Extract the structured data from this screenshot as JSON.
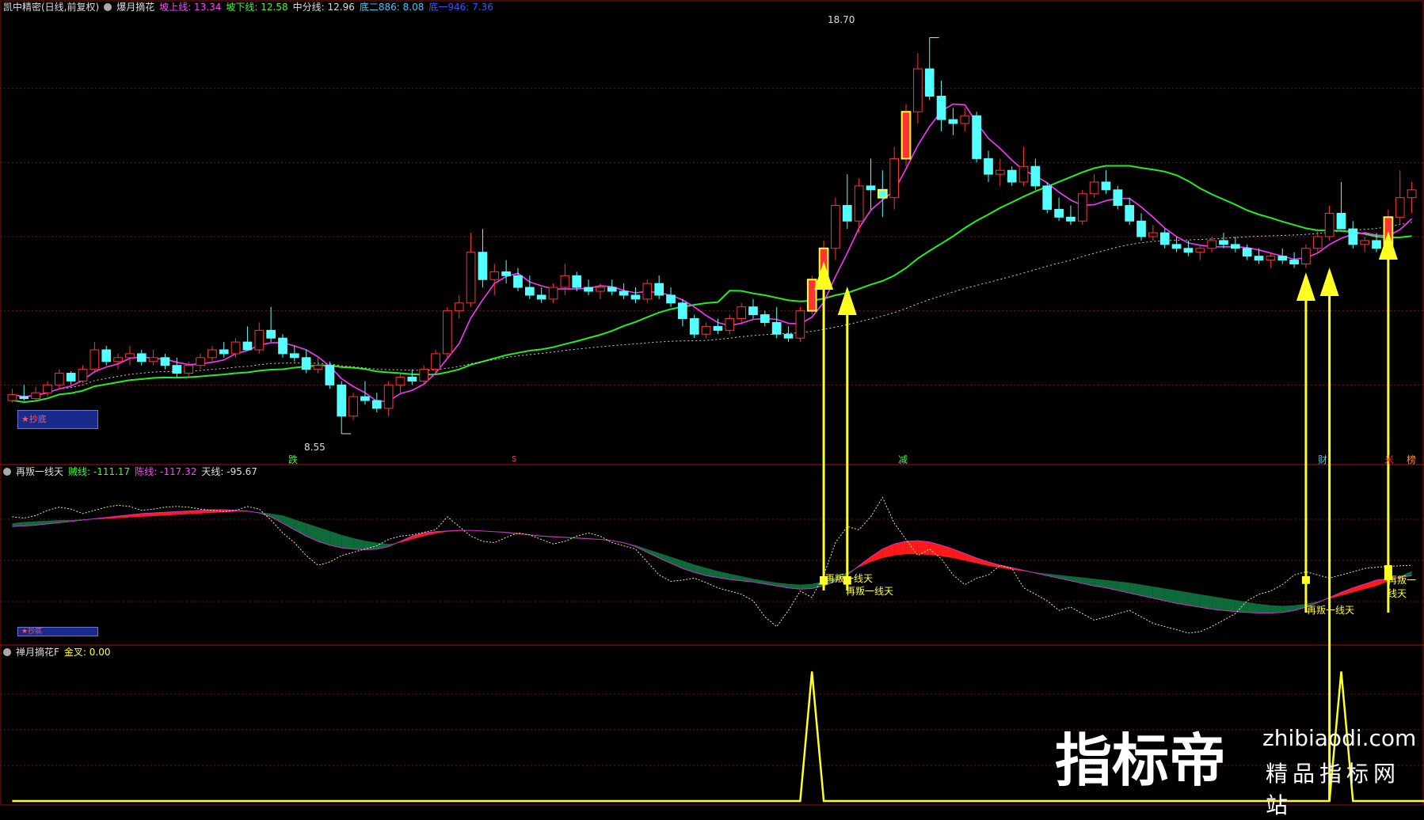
{
  "pane1": {
    "title": "凯中精密(日线,前复权)",
    "indicator": "爆月摘花",
    "items": [
      {
        "label": "坡上线: 13.34",
        "color": "#ff44ff"
      },
      {
        "label": "坡下线: 12.58",
        "color": "#33ff33"
      },
      {
        "label": "中分线: 12.96",
        "color": "#dddddd"
      },
      {
        "label": "底二886: 8.08",
        "color": "#33ccff"
      },
      {
        "label": "底一946: 7.36",
        "color": "#3355ff"
      }
    ],
    "high_label": "18.70",
    "low_label": "8.55",
    "signals": [
      {
        "text": "跌",
        "color": "#33ff33"
      },
      {
        "text": "s",
        "color": "#ff3333"
      },
      {
        "text": "减",
        "color": "#33ff33"
      },
      {
        "text": "财",
        "color": "#33ccff"
      },
      {
        "text": "米",
        "color": "#ff3333"
      },
      {
        "text": "榜",
        "color": "#ff8833"
      }
    ],
    "badge": "★抄底"
  },
  "pane2": {
    "title": "再叛一线天",
    "items": [
      {
        "label": "贼线: -111.17",
        "color": "#33ff33"
      },
      {
        "label": "陈线: -117.32",
        "color": "#ff44ff"
      },
      {
        "label": "天线: -95.67",
        "color": "#dddddd"
      }
    ],
    "signal_label": "再叛一线天",
    "badge": "★抄底"
  },
  "pane3": {
    "title": "禅月摘花F",
    "items": [
      {
        "label": "金叉: 0.00",
        "color": "#ffff33"
      }
    ]
  },
  "watermark": {
    "big": "指标帝",
    "url": "zhibiaodi.com",
    "sub": "精品指标网站"
  },
  "chart_data": {
    "type": "candlestick",
    "price": {
      "ohlc": [
        [
          9.4,
          9.7,
          9.35,
          9.55
        ],
        [
          9.5,
          9.8,
          9.4,
          9.45
        ],
        [
          9.45,
          9.75,
          9.4,
          9.6
        ],
        [
          9.6,
          9.9,
          9.5,
          9.8
        ],
        [
          9.8,
          10.2,
          9.7,
          10.1
        ],
        [
          10.1,
          10.15,
          9.8,
          9.9
        ],
        [
          9.9,
          10.3,
          9.85,
          10.2
        ],
        [
          10.2,
          10.9,
          10.1,
          10.7
        ],
        [
          10.7,
          10.8,
          10.3,
          10.4
        ],
        [
          10.4,
          10.6,
          10.2,
          10.5
        ],
        [
          10.5,
          10.8,
          10.3,
          10.6
        ],
        [
          10.6,
          10.7,
          10.3,
          10.4
        ],
        [
          10.4,
          10.7,
          10.3,
          10.5
        ],
        [
          10.5,
          10.6,
          10.2,
          10.3
        ],
        [
          10.3,
          10.5,
          10.0,
          10.1
        ],
        [
          10.1,
          10.4,
          10.0,
          10.3
        ],
        [
          10.3,
          10.6,
          10.2,
          10.5
        ],
        [
          10.5,
          10.8,
          10.4,
          10.7
        ],
        [
          10.7,
          10.9,
          10.5,
          10.6
        ],
        [
          10.6,
          11.0,
          10.5,
          10.9
        ],
        [
          10.9,
          11.3,
          10.8,
          10.7
        ],
        [
          10.7,
          11.4,
          10.6,
          11.2
        ],
        [
          11.2,
          11.8,
          10.9,
          11.0
        ],
        [
          11.0,
          11.1,
          10.5,
          10.6
        ],
        [
          10.6,
          10.8,
          10.4,
          10.5
        ],
        [
          10.5,
          10.7,
          10.1,
          10.2
        ],
        [
          10.2,
          10.5,
          10.1,
          10.3
        ],
        [
          10.3,
          10.4,
          9.7,
          9.8
        ],
        [
          9.8,
          9.9,
          8.55,
          9.0
        ],
        [
          9.0,
          9.6,
          8.9,
          9.5
        ],
        [
          9.5,
          9.9,
          9.3,
          9.4
        ],
        [
          9.4,
          9.6,
          9.1,
          9.2
        ],
        [
          9.2,
          9.9,
          9.0,
          9.8
        ],
        [
          9.8,
          10.1,
          9.6,
          10.0
        ],
        [
          10.0,
          10.2,
          9.8,
          9.9
        ],
        [
          9.9,
          10.3,
          9.8,
          10.2
        ],
        [
          10.2,
          10.7,
          10.1,
          10.6
        ],
        [
          10.6,
          11.8,
          10.5,
          11.7
        ],
        [
          11.7,
          12.1,
          11.5,
          11.9
        ],
        [
          11.9,
          13.7,
          11.8,
          13.2
        ],
        [
          13.2,
          13.8,
          12.3,
          12.5
        ],
        [
          12.5,
          12.9,
          12.1,
          12.7
        ],
        [
          12.7,
          13.0,
          12.4,
          12.6
        ],
        [
          12.6,
          12.8,
          12.2,
          12.3
        ],
        [
          12.3,
          12.6,
          12.0,
          12.1
        ],
        [
          12.1,
          12.3,
          11.9,
          12.0
        ],
        [
          12.0,
          12.4,
          11.9,
          12.3
        ],
        [
          12.3,
          12.9,
          12.1,
          12.6
        ],
        [
          12.6,
          12.7,
          12.2,
          12.3
        ],
        [
          12.3,
          12.5,
          12.1,
          12.2
        ],
        [
          12.2,
          12.4,
          12.0,
          12.3
        ],
        [
          12.3,
          12.5,
          12.1,
          12.2
        ],
        [
          12.2,
          12.4,
          12.0,
          12.1
        ],
        [
          12.1,
          12.3,
          11.9,
          12.0
        ],
        [
          12.0,
          12.5,
          11.9,
          12.4
        ],
        [
          12.4,
          12.6,
          12.0,
          12.1
        ],
        [
          12.1,
          12.3,
          11.8,
          11.9
        ],
        [
          11.9,
          12.0,
          11.3,
          11.5
        ],
        [
          11.5,
          11.6,
          11.0,
          11.1
        ],
        [
          11.1,
          11.4,
          11.0,
          11.3
        ],
        [
          11.3,
          11.5,
          11.1,
          11.2
        ],
        [
          11.2,
          11.6,
          11.1,
          11.5
        ],
        [
          11.5,
          11.9,
          11.4,
          11.8
        ],
        [
          11.8,
          12.0,
          11.5,
          11.6
        ],
        [
          11.6,
          11.7,
          11.3,
          11.4
        ],
        [
          11.4,
          11.8,
          11.0,
          11.1
        ],
        [
          11.1,
          11.3,
          10.9,
          11.0
        ],
        [
          11.0,
          11.8,
          10.9,
          11.7
        ],
        [
          11.7,
          12.6,
          11.6,
          12.5
        ],
        [
          12.5,
          13.5,
          12.2,
          13.3
        ],
        [
          13.3,
          14.6,
          13.0,
          14.4
        ],
        [
          14.4,
          15.2,
          13.8,
          14.0
        ],
        [
          14.0,
          15.1,
          13.7,
          14.9
        ],
        [
          14.9,
          15.6,
          14.3,
          14.8
        ],
        [
          14.8,
          15.3,
          14.1,
          14.6
        ],
        [
          14.6,
          15.9,
          14.3,
          15.6
        ],
        [
          15.6,
          17.0,
          15.4,
          16.8
        ],
        [
          16.8,
          18.3,
          16.5,
          17.9
        ],
        [
          17.9,
          18.7,
          17.1,
          17.2
        ],
        [
          17.2,
          17.6,
          16.3,
          16.6
        ],
        [
          16.6,
          16.9,
          16.2,
          16.5
        ],
        [
          16.5,
          16.9,
          16.3,
          16.7
        ],
        [
          16.7,
          16.8,
          15.5,
          15.6
        ],
        [
          15.6,
          15.8,
          15.0,
          15.2
        ],
        [
          15.2,
          15.6,
          14.9,
          15.3
        ],
        [
          15.3,
          15.4,
          14.9,
          15.0
        ],
        [
          15.0,
          15.9,
          14.9,
          15.4
        ],
        [
          15.4,
          15.6,
          14.8,
          14.9
        ],
        [
          14.9,
          15.0,
          14.2,
          14.3
        ],
        [
          14.3,
          14.6,
          14.0,
          14.1
        ],
        [
          14.1,
          14.4,
          13.9,
          14.0
        ],
        [
          14.0,
          14.8,
          13.9,
          14.7
        ],
        [
          14.7,
          15.2,
          14.6,
          15.0
        ],
        [
          15.0,
          15.3,
          14.7,
          14.8
        ],
        [
          14.8,
          14.9,
          14.3,
          14.4
        ],
        [
          14.4,
          14.6,
          13.9,
          14.0
        ],
        [
          14.0,
          14.2,
          13.5,
          13.6
        ],
        [
          13.6,
          13.9,
          13.5,
          13.7
        ],
        [
          13.7,
          13.8,
          13.3,
          13.4
        ],
        [
          13.4,
          13.6,
          13.2,
          13.3
        ],
        [
          13.3,
          13.5,
          13.1,
          13.2
        ],
        [
          13.2,
          13.4,
          13.0,
          13.3
        ],
        [
          13.3,
          13.6,
          13.2,
          13.5
        ],
        [
          13.5,
          13.7,
          13.3,
          13.4
        ],
        [
          13.4,
          13.6,
          13.2,
          13.3
        ],
        [
          13.3,
          13.4,
          13.0,
          13.1
        ],
        [
          13.1,
          13.3,
          12.9,
          13.0
        ],
        [
          13.0,
          13.2,
          12.8,
          13.1
        ],
        [
          13.1,
          13.3,
          12.9,
          13.0
        ],
        [
          13.0,
          13.2,
          12.8,
          12.9
        ],
        [
          12.9,
          13.4,
          12.8,
          13.3
        ],
        [
          13.3,
          13.8,
          13.2,
          13.6
        ],
        [
          13.6,
          14.4,
          13.5,
          14.2
        ],
        [
          14.2,
          15.0,
          14.0,
          13.8
        ],
        [
          13.8,
          14.0,
          13.3,
          13.4
        ],
        [
          13.4,
          13.6,
          13.2,
          13.5
        ],
        [
          13.5,
          13.7,
          13.2,
          13.3
        ],
        [
          13.3,
          14.3,
          13.2,
          14.1
        ],
        [
          14.1,
          15.3,
          13.9,
          14.6
        ],
        [
          14.6,
          15.0,
          14.2,
          14.8
        ]
      ],
      "high_marker": 18.7,
      "low_marker": 8.55,
      "ylim": [
        7.9,
        19.3
      ]
    },
    "osc": {
      "slow_line": [
        -30,
        -28,
        -27,
        -26,
        -25,
        -25,
        -24,
        -24,
        -23,
        -22,
        -21,
        -20,
        -19,
        -18,
        -17,
        -16,
        -15,
        -14,
        -13,
        -12,
        -12,
        -13,
        -15,
        -18,
        -24,
        -30,
        -36,
        -42,
        -48,
        -53,
        -57,
        -60,
        -62,
        -60,
        -55,
        -50,
        -46,
        -43,
        -42,
        -41,
        -42,
        -43,
        -45,
        -47,
        -48,
        -49,
        -50,
        -51,
        -52,
        -53,
        -55,
        -57,
        -60,
        -64,
        -70,
        -76,
        -82,
        -88,
        -94,
        -99,
        -104,
        -108,
        -112,
        -116,
        -119,
        -122,
        -124,
        -125,
        -124,
        -120,
        -114,
        -106,
        -98,
        -90,
        -84,
        -80,
        -78,
        -78,
        -79,
        -81,
        -84,
        -88,
        -92,
        -96,
        -99,
        -102,
        -104,
        -106,
        -108,
        -110,
        -112,
        -114,
        -116,
        -118,
        -120,
        -122,
        -125,
        -128,
        -131,
        -134,
        -137,
        -140,
        -143,
        -146,
        -149,
        -152,
        -155,
        -157,
        -158,
        -157,
        -155,
        -151,
        -147,
        -142,
        -137,
        -132,
        -127,
        -120,
        -112,
        -104
      ],
      "fast_line": [
        -35,
        -34,
        -33,
        -31,
        -29,
        -27,
        -25,
        -23,
        -21,
        -19,
        -17,
        -15,
        -14,
        -13,
        -12,
        -11,
        -10,
        -9,
        -9,
        -10,
        -11,
        -14,
        -20,
        -30,
        -40,
        -50,
        -58,
        -64,
        -68,
        -70,
        -71,
        -70,
        -66,
        -58,
        -50,
        -45,
        -43,
        -42,
        -41,
        -41,
        -42,
        -43,
        -44,
        -46,
        -48,
        -50,
        -51,
        -52,
        -53,
        -54,
        -55,
        -57,
        -60,
        -66,
        -75,
        -84,
        -92,
        -100,
        -106,
        -111,
        -114,
        -117,
        -119,
        -121,
        -124,
        -127,
        -130,
        -132,
        -131,
        -127,
        -120,
        -110,
        -96,
        -82,
        -70,
        -62,
        -58,
        -57,
        -59,
        -64,
        -70,
        -77,
        -84,
        -90,
        -95,
        -99,
        -103,
        -107,
        -111,
        -115,
        -119,
        -123,
        -127,
        -130,
        -134,
        -138,
        -142,
        -146,
        -150,
        -154,
        -157,
        -160,
        -163,
        -165,
        -167,
        -168,
        -169,
        -169,
        -168,
        -165,
        -160,
        -153,
        -145,
        -137,
        -130,
        -124,
        -118,
        -116,
        -114,
        -111
      ],
      "sky_line": [
        -20,
        -22,
        -18,
        -10,
        -5,
        -8,
        -15,
        -10,
        -5,
        -2,
        -4,
        -10,
        -8,
        -5,
        -4,
        -5,
        -8,
        -10,
        -12,
        -10,
        -4,
        -8,
        -25,
        -45,
        -60,
        -80,
        -95,
        -90,
        -80,
        -75,
        -70,
        -65,
        -55,
        -50,
        -48,
        -44,
        -40,
        -20,
        -35,
        -50,
        -58,
        -60,
        -52,
        -45,
        -48,
        -55,
        -62,
        -58,
        -50,
        -45,
        -50,
        -60,
        -65,
        -70,
        -90,
        -110,
        -120,
        -118,
        -115,
        -122,
        -130,
        -135,
        -140,
        -150,
        -175,
        -190,
        -165,
        -135,
        -145,
        -110,
        -60,
        -35,
        -40,
        -20,
        10,
        -30,
        -55,
        -80,
        -70,
        -85,
        -110,
        -125,
        -115,
        -110,
        -95,
        -100,
        -130,
        -140,
        -150,
        -165,
        -160,
        -170,
        -180,
        -175,
        -170,
        -165,
        -175,
        -185,
        -190,
        -195,
        -200,
        -198,
        -190,
        -180,
        -170,
        -150,
        -140,
        -135,
        -125,
        -110,
        -105,
        -110,
        -115,
        -110,
        -105,
        -100,
        -98,
        -97,
        -96,
        -95
      ],
      "signal_bars": [
        [
          -125,
          -112
        ],
        [
          -125,
          -112
        ],
        [
          -124,
          -112
        ],
        [
          -118,
          -95
        ]
      ],
      "ylim": [
        -215,
        40
      ]
    },
    "cross": {
      "values": [
        0,
        0,
        0,
        0,
        0,
        0,
        0,
        0,
        0,
        0,
        0,
        0,
        0,
        0,
        0,
        0,
        0,
        0,
        0,
        0,
        0,
        0,
        0,
        0,
        0,
        0,
        0,
        0,
        0,
        0,
        0,
        0,
        0,
        0,
        0,
        0,
        0,
        0,
        0,
        0,
        0,
        0,
        0,
        0,
        0,
        0,
        0,
        0,
        0,
        0,
        0,
        0,
        0,
        0,
        0,
        0,
        0,
        0,
        0,
        0,
        0,
        0,
        0,
        0,
        0,
        0,
        0,
        0,
        1,
        0,
        0,
        0,
        0,
        0,
        0,
        0,
        0,
        0,
        0,
        0,
        0,
        0,
        0,
        0,
        0,
        0,
        0,
        0,
        0,
        0,
        0,
        0,
        0,
        0,
        0,
        0,
        0,
        0,
        0,
        0,
        0,
        0,
        0,
        0,
        0,
        0,
        0,
        0,
        0,
        0,
        0,
        0,
        0,
        1,
        0,
        0,
        0,
        0,
        0,
        0,
        0,
        0
      ],
      "ylim": [
        0,
        1.1
      ]
    },
    "arrows": [
      {
        "index": 69
      },
      {
        "index": 71
      },
      {
        "index": 110
      },
      {
        "index": 112
      },
      {
        "index": 117
      }
    ]
  }
}
